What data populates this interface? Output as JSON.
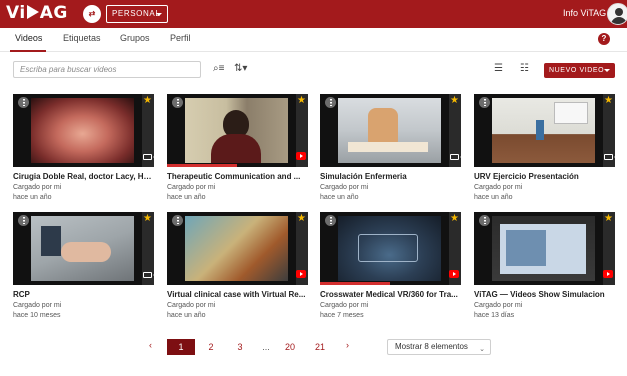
{
  "header": {
    "logo_text": "Vi",
    "logo_text2": "AG",
    "account_dropdown": "PERSONAL",
    "user_name": "Info ViTAG"
  },
  "tabs": [
    {
      "label": "Videos",
      "active": true
    },
    {
      "label": "Etiquetas",
      "active": false
    },
    {
      "label": "Grupos",
      "active": false
    },
    {
      "label": "Perfil",
      "active": false
    }
  ],
  "toolbar": {
    "search_placeholder": "Escriba para buscar videos",
    "new_video_label": "NUEVO VIDEO"
  },
  "videos": [
    {
      "title": "Cirugia Doble Real, doctor Lacy, Ho...",
      "uploader": "Cargado por mi",
      "age": "hace un año",
      "source": "camera",
      "progress": 0
    },
    {
      "title": "Therapeutic Communication and ...",
      "uploader": "Cargado por mi",
      "age": "hace un año",
      "source": "youtube",
      "progress": 0.5
    },
    {
      "title": "Simulación Enfermeria",
      "uploader": "Cargado por mi",
      "age": "hace un año",
      "source": "camera",
      "progress": 0
    },
    {
      "title": "URV Ejercicio Presentación",
      "uploader": "Cargado por mi",
      "age": "hace un año",
      "source": "camera",
      "progress": 0
    },
    {
      "title": "RCP",
      "uploader": "Cargado por mi",
      "age": "hace 10 meses",
      "source": "camera",
      "progress": 0
    },
    {
      "title": "Virtual clinical case with Virtual Re...",
      "uploader": "Cargado por mi",
      "age": "hace un año",
      "source": "youtube",
      "progress": 0
    },
    {
      "title": "Crosswater Medical VR/360 for Tra...",
      "uploader": "Cargado por mi",
      "age": "hace 7 meses",
      "source": "youtube",
      "progress": 0.5
    },
    {
      "title": "ViTAG — Videos Show Simulacion",
      "uploader": "Cargado por mi",
      "age": "hace 13 días",
      "source": "youtube",
      "progress": 0
    }
  ],
  "pagination": {
    "prev": "‹",
    "pages": [
      "1",
      "2",
      "3",
      "...",
      "20",
      "21"
    ],
    "current": "1",
    "next": "›",
    "per_page": "Mostrar 8 elementos"
  },
  "colors": {
    "brand": "#a31a1c",
    "star": "#f5b800",
    "youtube": "#ff0000"
  }
}
